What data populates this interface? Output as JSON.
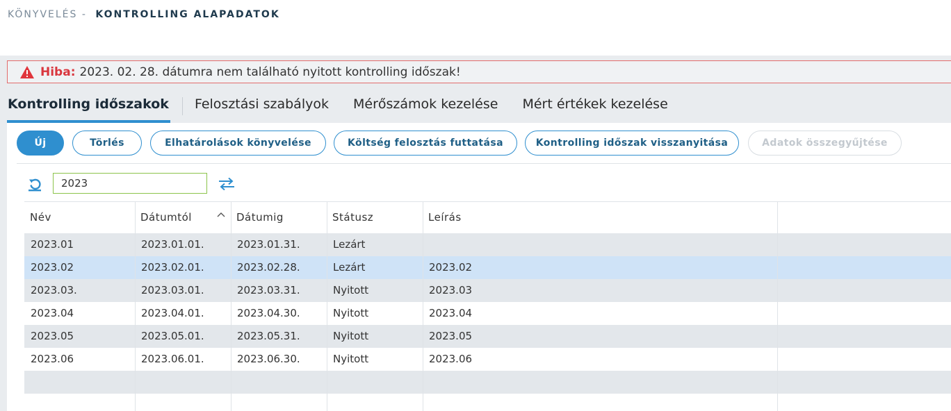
{
  "breadcrumb": {
    "parent": "KÖNYVELÉS",
    "separator": "-",
    "current": "KONTROLLING ALAPADATOK"
  },
  "error": {
    "label": "Hiba:",
    "message": "2023. 02. 28. dátumra nem található nyitott kontrolling időszak!"
  },
  "tabs": [
    {
      "label": "Kontrolling időszakok",
      "active": true
    },
    {
      "label": "Felosztási szabályok"
    },
    {
      "label": "Mérőszámok kezelése"
    },
    {
      "label": "Mért értékek kezelése"
    }
  ],
  "toolbar": {
    "new": "Új",
    "delete": "Törlés",
    "accruals": "Elhatárolások könyvelése",
    "cost_allocation": "Költség felosztás futtatása",
    "reopen_period": "Kontrolling időszak visszanyitása",
    "collect_data": "Adatok összegyűjtése"
  },
  "filter": {
    "year_value": "2023"
  },
  "table": {
    "columns": [
      "Név",
      "Dátumtól",
      "Dátumig",
      "Státusz",
      "Leírás"
    ],
    "sorted_column": "Dátumtól",
    "rows": [
      {
        "name": "2023.01",
        "from": "2023.01.01.",
        "to": "2023.01.31.",
        "status": "Lezárt",
        "desc": ""
      },
      {
        "name": "2023.02",
        "from": "2023.02.01.",
        "to": "2023.02.28.",
        "status": "Lezárt",
        "desc": "2023.02",
        "selected": true
      },
      {
        "name": "2023.03.",
        "from": "2023.03.01.",
        "to": "2023.03.31.",
        "status": "Nyitott",
        "desc": "2023.03"
      },
      {
        "name": "2023.04",
        "from": "2023.04.01.",
        "to": "2023.04.30.",
        "status": "Nyitott",
        "desc": "2023.04"
      },
      {
        "name": "2023.05",
        "from": "2023.05.01.",
        "to": "2023.05.31.",
        "status": "Nyitott",
        "desc": "2023.05"
      },
      {
        "name": "2023.06",
        "from": "2023.06.01.",
        "to": "2023.06.30.",
        "status": "Nyitott",
        "desc": "2023.06"
      }
    ]
  },
  "colors": {
    "accent": "#2f8fcf",
    "error": "#d9363e",
    "input_border": "#8bc34a",
    "selected_row": "#cfe3f7"
  },
  "icons": {
    "warning": "warning-triangle-icon",
    "reload": "reload-icon",
    "swap": "swap-arrows-icon",
    "sort": "sort-ascending-icon"
  }
}
